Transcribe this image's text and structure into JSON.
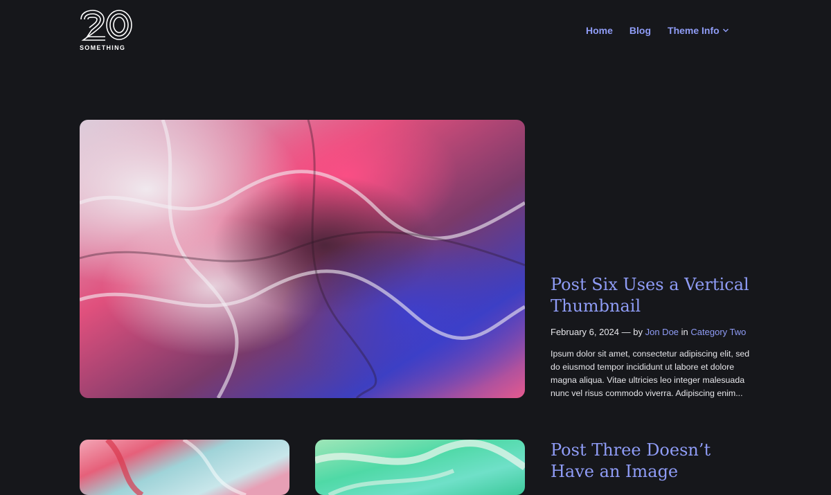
{
  "site": {
    "logo_text": "SOMETHING",
    "logo_number": "20"
  },
  "nav": {
    "items": [
      {
        "label": "Home"
      },
      {
        "label": "Blog"
      },
      {
        "label": "Theme Info"
      }
    ]
  },
  "featured_post": {
    "title": "Post Six Uses a Vertical Thumbnail",
    "date": "February 6, 2024",
    "by_prefix": "— by",
    "author": "Jon Doe",
    "in_word": "in",
    "category": "Category Two",
    "excerpt": "Ipsum dolor sit amet, consectetur adipiscing elit, sed do eiusmod tempor incididunt ut labore et dolore magna aliqua. Vitae ultricies leo integer malesuada nunc vel risus commodo viverra. Adipiscing enim..."
  },
  "posts": [
    {
      "title": "Post Three Doesn’t Have an Image"
    }
  ],
  "colors": {
    "background": "#16171b",
    "accent": "#8f9cf6",
    "text": "#e6e6ea"
  }
}
